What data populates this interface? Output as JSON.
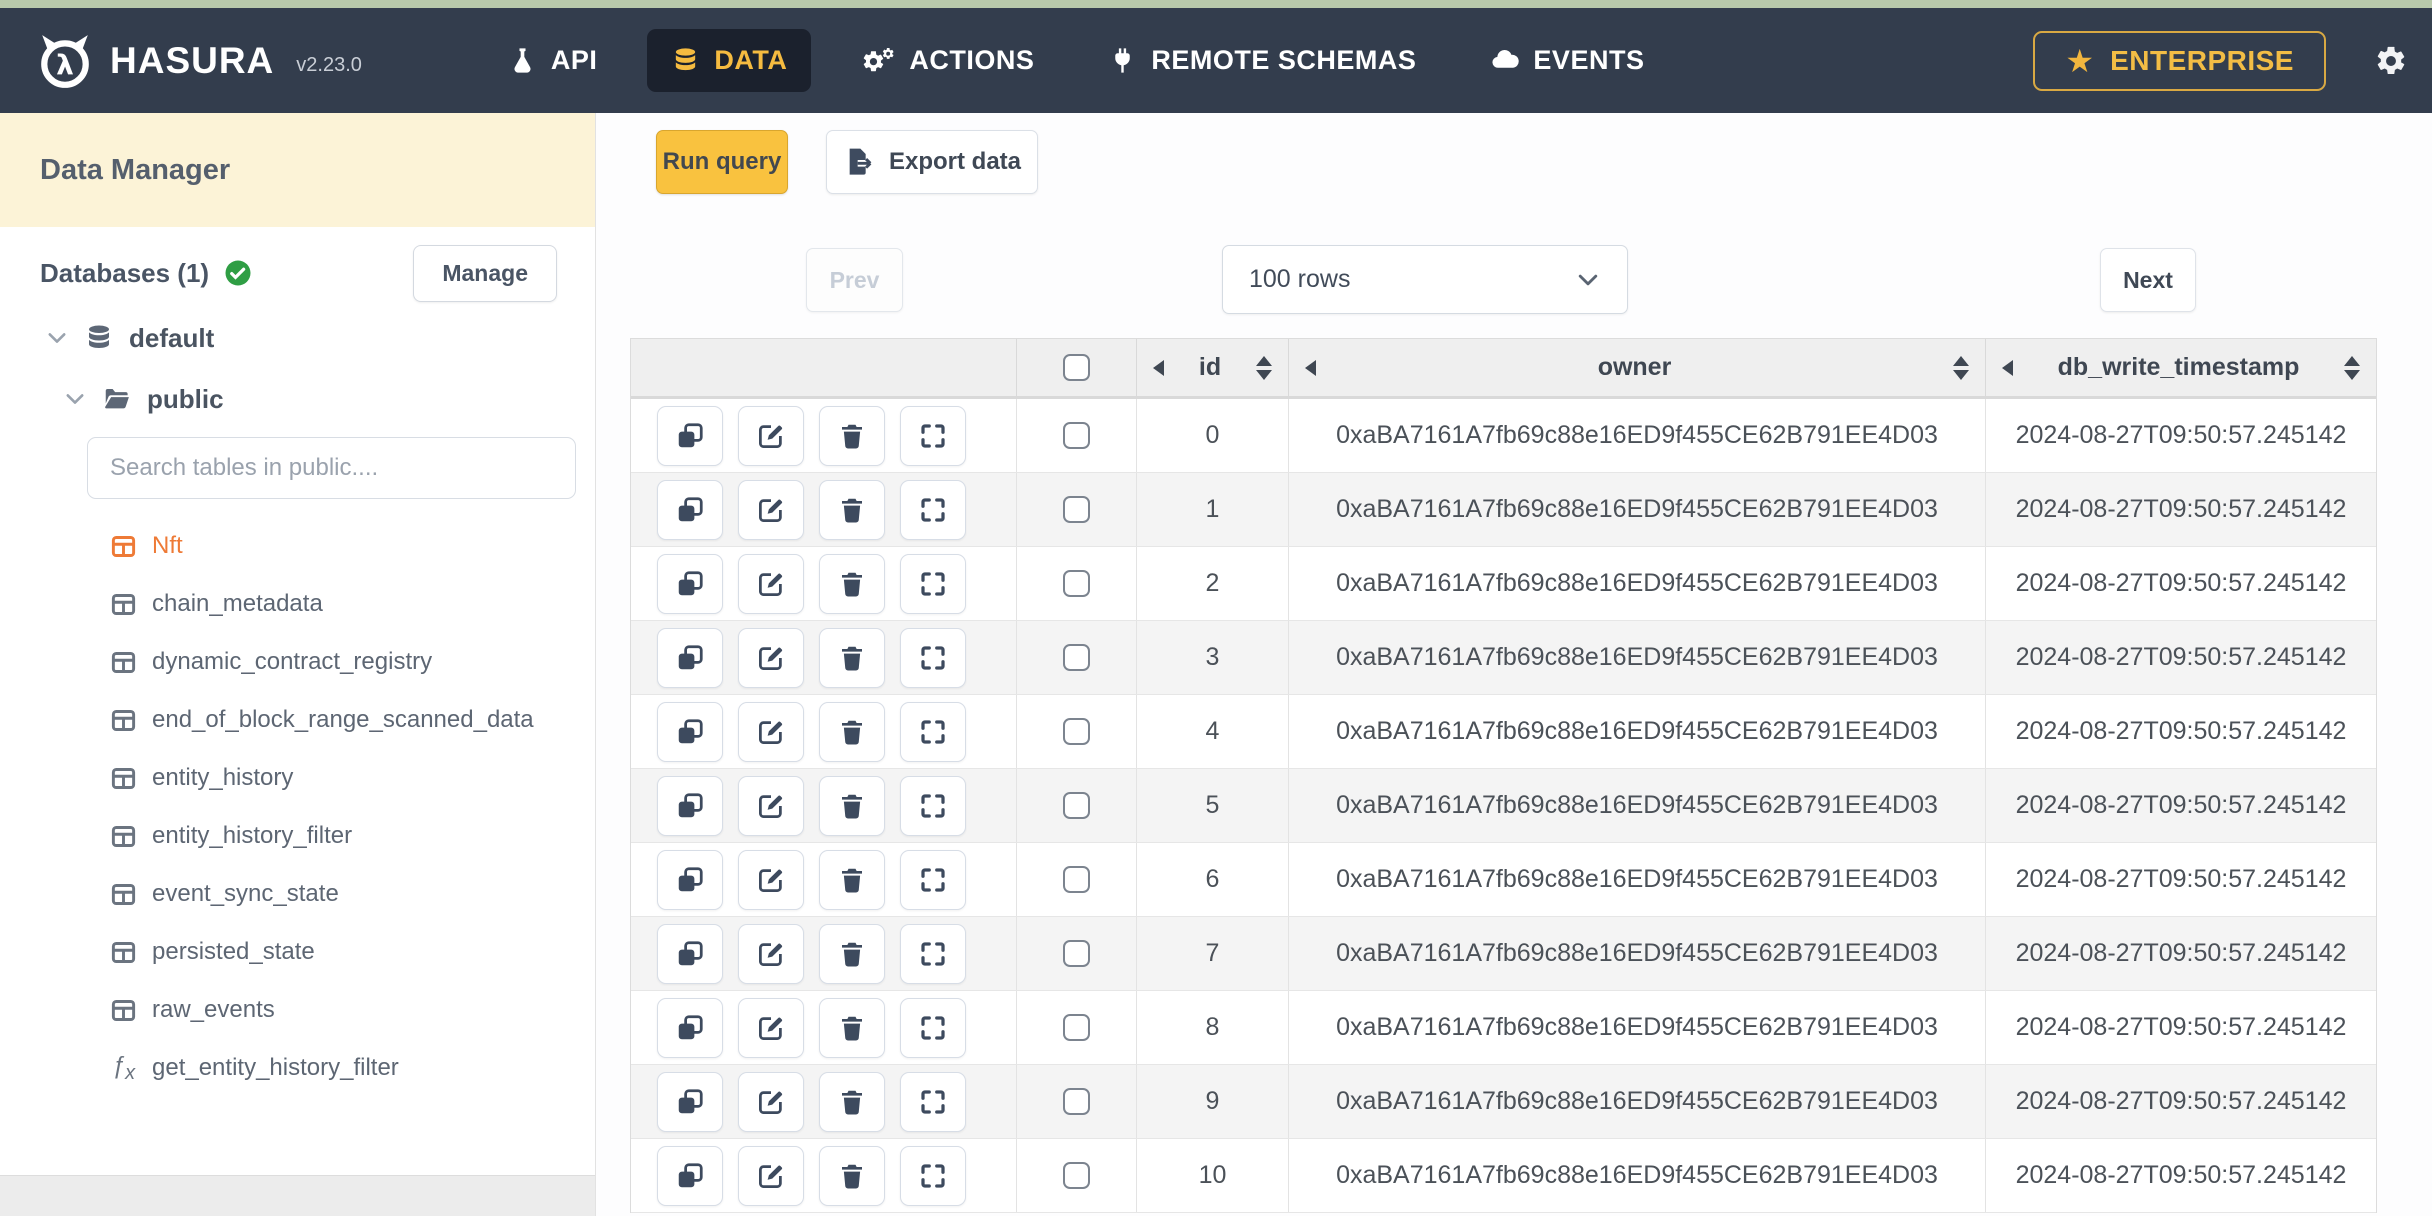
{
  "topbar": {
    "brand": "HASURA",
    "version": "v2.23.0",
    "nav_items": [
      {
        "label": "API",
        "icon": "flask-icon",
        "active": false
      },
      {
        "label": "DATA",
        "icon": "database-icon",
        "active": true
      },
      {
        "label": "ACTIONS",
        "icon": "gears-icon",
        "active": false
      },
      {
        "label": "REMOTE SCHEMAS",
        "icon": "plug-icon",
        "active": false
      },
      {
        "label": "EVENTS",
        "icon": "cloud-icon",
        "active": false
      }
    ],
    "enterprise_button": "ENTERPRISE"
  },
  "sidebar": {
    "title": "Data Manager",
    "databases_label": "Databases (1)",
    "manage_button": "Manage",
    "tree": {
      "database": "default",
      "schema": "public"
    },
    "search_placeholder": "Search tables in public....",
    "tables": [
      {
        "name": "Nft",
        "type": "table",
        "active": true
      },
      {
        "name": "chain_metadata",
        "type": "table",
        "active": false
      },
      {
        "name": "dynamic_contract_registry",
        "type": "table",
        "active": false
      },
      {
        "name": "end_of_block_range_scanned_data",
        "type": "table",
        "active": false
      },
      {
        "name": "entity_history",
        "type": "table",
        "active": false
      },
      {
        "name": "entity_history_filter",
        "type": "table",
        "active": false
      },
      {
        "name": "event_sync_state",
        "type": "table",
        "active": false
      },
      {
        "name": "persisted_state",
        "type": "table",
        "active": false
      },
      {
        "name": "raw_events",
        "type": "table",
        "active": false
      },
      {
        "name": "get_entity_history_filter",
        "type": "function",
        "active": false
      }
    ]
  },
  "toolbar": {
    "run_query": "Run query",
    "export_data": "Export data"
  },
  "pagination": {
    "prev": "Prev",
    "rows_selected": "100 rows",
    "next": "Next"
  },
  "data_table": {
    "columns": [
      {
        "key": "id",
        "label": "id"
      },
      {
        "key": "owner",
        "label": "owner"
      },
      {
        "key": "db_write_timestamp",
        "label": "db_write_timestamp"
      }
    ],
    "rows": [
      {
        "id": "0",
        "owner": "0xaBA7161A7fb69c88e16ED9f455CE62B791EE4D03",
        "db_write_timestamp": "2024-08-27T09:50:57.245142"
      },
      {
        "id": "1",
        "owner": "0xaBA7161A7fb69c88e16ED9f455CE62B791EE4D03",
        "db_write_timestamp": "2024-08-27T09:50:57.245142"
      },
      {
        "id": "2",
        "owner": "0xaBA7161A7fb69c88e16ED9f455CE62B791EE4D03",
        "db_write_timestamp": "2024-08-27T09:50:57.245142"
      },
      {
        "id": "3",
        "owner": "0xaBA7161A7fb69c88e16ED9f455CE62B791EE4D03",
        "db_write_timestamp": "2024-08-27T09:50:57.245142"
      },
      {
        "id": "4",
        "owner": "0xaBA7161A7fb69c88e16ED9f455CE62B791EE4D03",
        "db_write_timestamp": "2024-08-27T09:50:57.245142"
      },
      {
        "id": "5",
        "owner": "0xaBA7161A7fb69c88e16ED9f455CE62B791EE4D03",
        "db_write_timestamp": "2024-08-27T09:50:57.245142"
      },
      {
        "id": "6",
        "owner": "0xaBA7161A7fb69c88e16ED9f455CE62B791EE4D03",
        "db_write_timestamp": "2024-08-27T09:50:57.245142"
      },
      {
        "id": "7",
        "owner": "0xaBA7161A7fb69c88e16ED9f455CE62B791EE4D03",
        "db_write_timestamp": "2024-08-27T09:50:57.245142"
      },
      {
        "id": "8",
        "owner": "0xaBA7161A7fb69c88e16ED9f455CE62B791EE4D03",
        "db_write_timestamp": "2024-08-27T09:50:57.245142"
      },
      {
        "id": "9",
        "owner": "0xaBA7161A7fb69c88e16ED9f455CE62B791EE4D03",
        "db_write_timestamp": "2024-08-27T09:50:57.245142"
      },
      {
        "id": "10",
        "owner": "0xaBA7161A7fb69c88e16ED9f455CE62B791EE4D03",
        "db_write_timestamp": "2024-08-27T09:50:57.245142"
      }
    ]
  },
  "colors": {
    "navbar_bg": "#333d4d",
    "accent_yellow": "#f5bb40",
    "header_cream": "#fcf3d7",
    "active_table_orange": "#ee7a36",
    "success_green": "#2f9e44",
    "top_strip_green": "#b8c9ab"
  }
}
